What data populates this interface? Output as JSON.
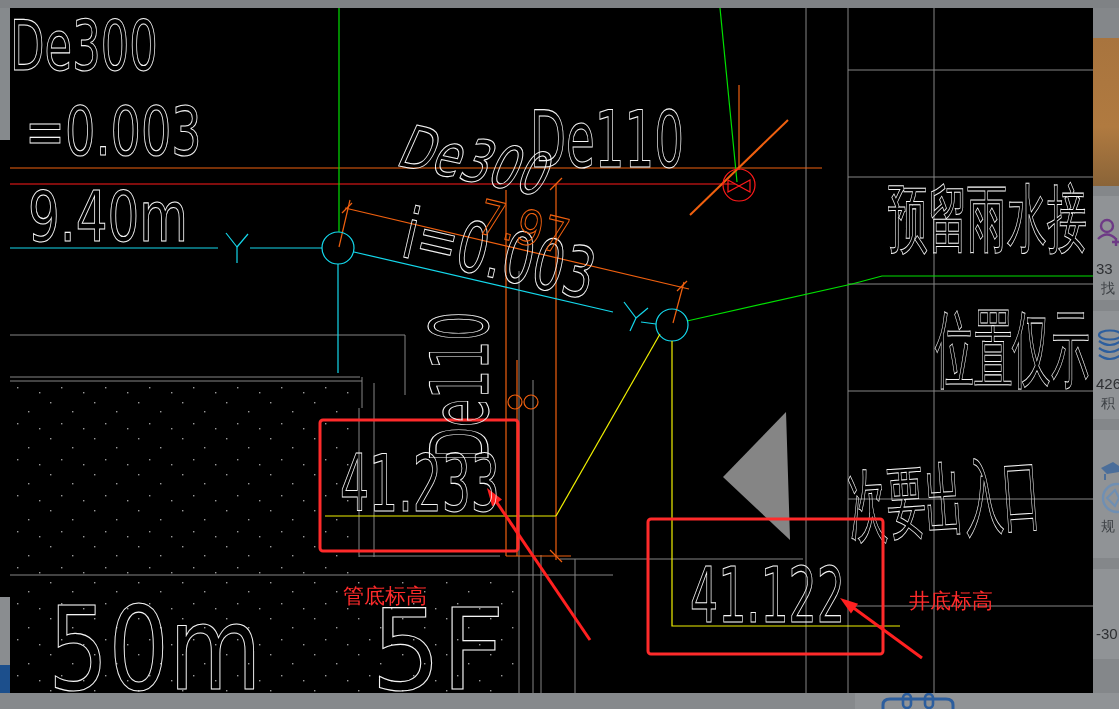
{
  "cad_drawing": {
    "texts": [
      "De300",
      "=0.003",
      "9.40m",
      "De300",
      "De110",
      "i=0.003",
      "De110",
      "预留雨水接",
      "位置仅示",
      "次要出入口",
      "50m",
      "5F"
    ],
    "dimension": "7.97"
  },
  "callouts": [
    {
      "elevation": "41.233",
      "note": "管底标高"
    },
    {
      "elevation": "41.122",
      "note": "井底标高"
    }
  ],
  "page_behind": {
    "side_panel_texts": [
      "33",
      "找",
      "426",
      "积",
      "规",
      "-30"
    ]
  }
}
